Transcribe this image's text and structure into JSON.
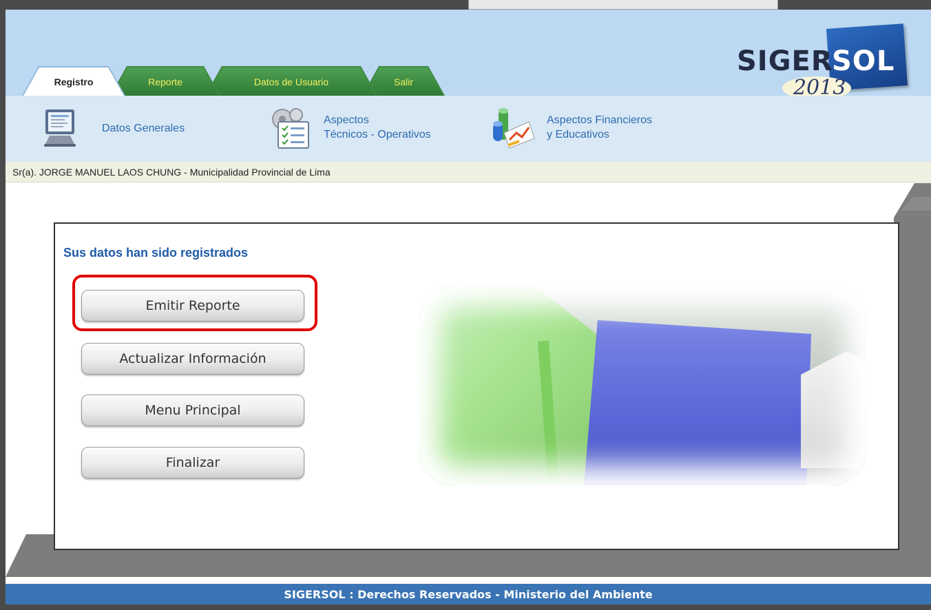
{
  "app": {
    "logo_a": "SIGER",
    "logo_b": "SOL",
    "logo_year": "2013"
  },
  "tabs": [
    {
      "label": "Registro",
      "active": true
    },
    {
      "label": "Reporte",
      "active": false
    },
    {
      "label": "Datos de Usuario",
      "active": false
    },
    {
      "label": "Salir",
      "active": false
    }
  ],
  "subnav": [
    {
      "line1": "Datos Generales",
      "line2": "",
      "icon": "computer-monitor-icon"
    },
    {
      "line1": "Aspectos",
      "line2": "Técnicos - Operativos",
      "icon": "checklist-gears-icon"
    },
    {
      "line1": "Aspectos Financieros",
      "line2": "y Educativos",
      "icon": "finance-chart-icon"
    }
  ],
  "user_line": "Sr(a). JORGE MANUEL LAOS CHUNG - Municipalidad Provincial de Lima",
  "panel": {
    "title": "Sus datos han sido registrados",
    "buttons": [
      "Emitir Reporte",
      "Actualizar Información",
      "Menu Principal",
      "Finalizar"
    ]
  },
  "footer": "SIGERSOL : Derechos Reservados - Ministerio del Ambiente",
  "colors": {
    "header": "#bcd8f2",
    "tab_green": "#3f8a42",
    "link_blue": "#2f6bb0",
    "footer_blue": "#3a74b4",
    "highlight_red": "#e00000"
  }
}
